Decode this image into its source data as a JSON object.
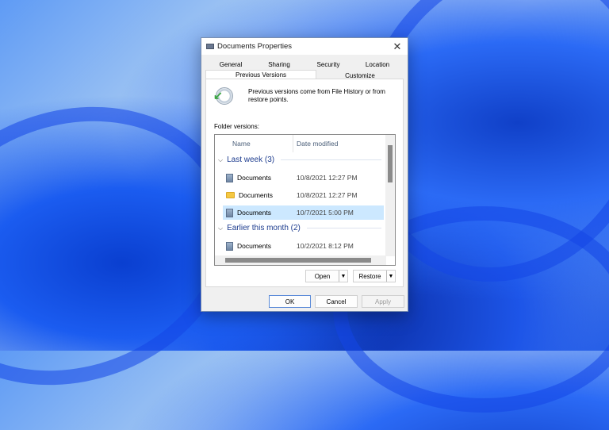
{
  "dialog": {
    "title": "Documents Properties",
    "close": "✕"
  },
  "tabs": [
    {
      "label": "General"
    },
    {
      "label": "Sharing"
    },
    {
      "label": "Security"
    },
    {
      "label": "Location"
    },
    {
      "label": "Previous Versions"
    },
    {
      "label": "Customize"
    }
  ],
  "info_text": "Previous versions come from File History or from restore points.",
  "folder_versions_label": "Folder versions:",
  "columns": {
    "name": "Name",
    "date": "Date modified"
  },
  "groups": [
    {
      "label": "Last week (3)",
      "items": [
        {
          "name": "Documents",
          "date": "10/8/2021 12:27 PM",
          "icon": "document-icon"
        },
        {
          "name": "Documents",
          "date": "10/8/2021 12:27 PM",
          "icon": "folder-icon"
        },
        {
          "name": "Documents",
          "date": "10/7/2021 5:00 PM",
          "icon": "document-icon",
          "selected": true
        }
      ]
    },
    {
      "label": "Earlier this month (2)",
      "items": [
        {
          "name": "Documents",
          "date": "10/2/2021 8:12 PM",
          "icon": "document-icon"
        }
      ]
    }
  ],
  "buttons": {
    "open": "Open",
    "restore": "Restore",
    "ok": "OK",
    "cancel": "Cancel",
    "apply": "Apply",
    "dropdown": "▼"
  }
}
